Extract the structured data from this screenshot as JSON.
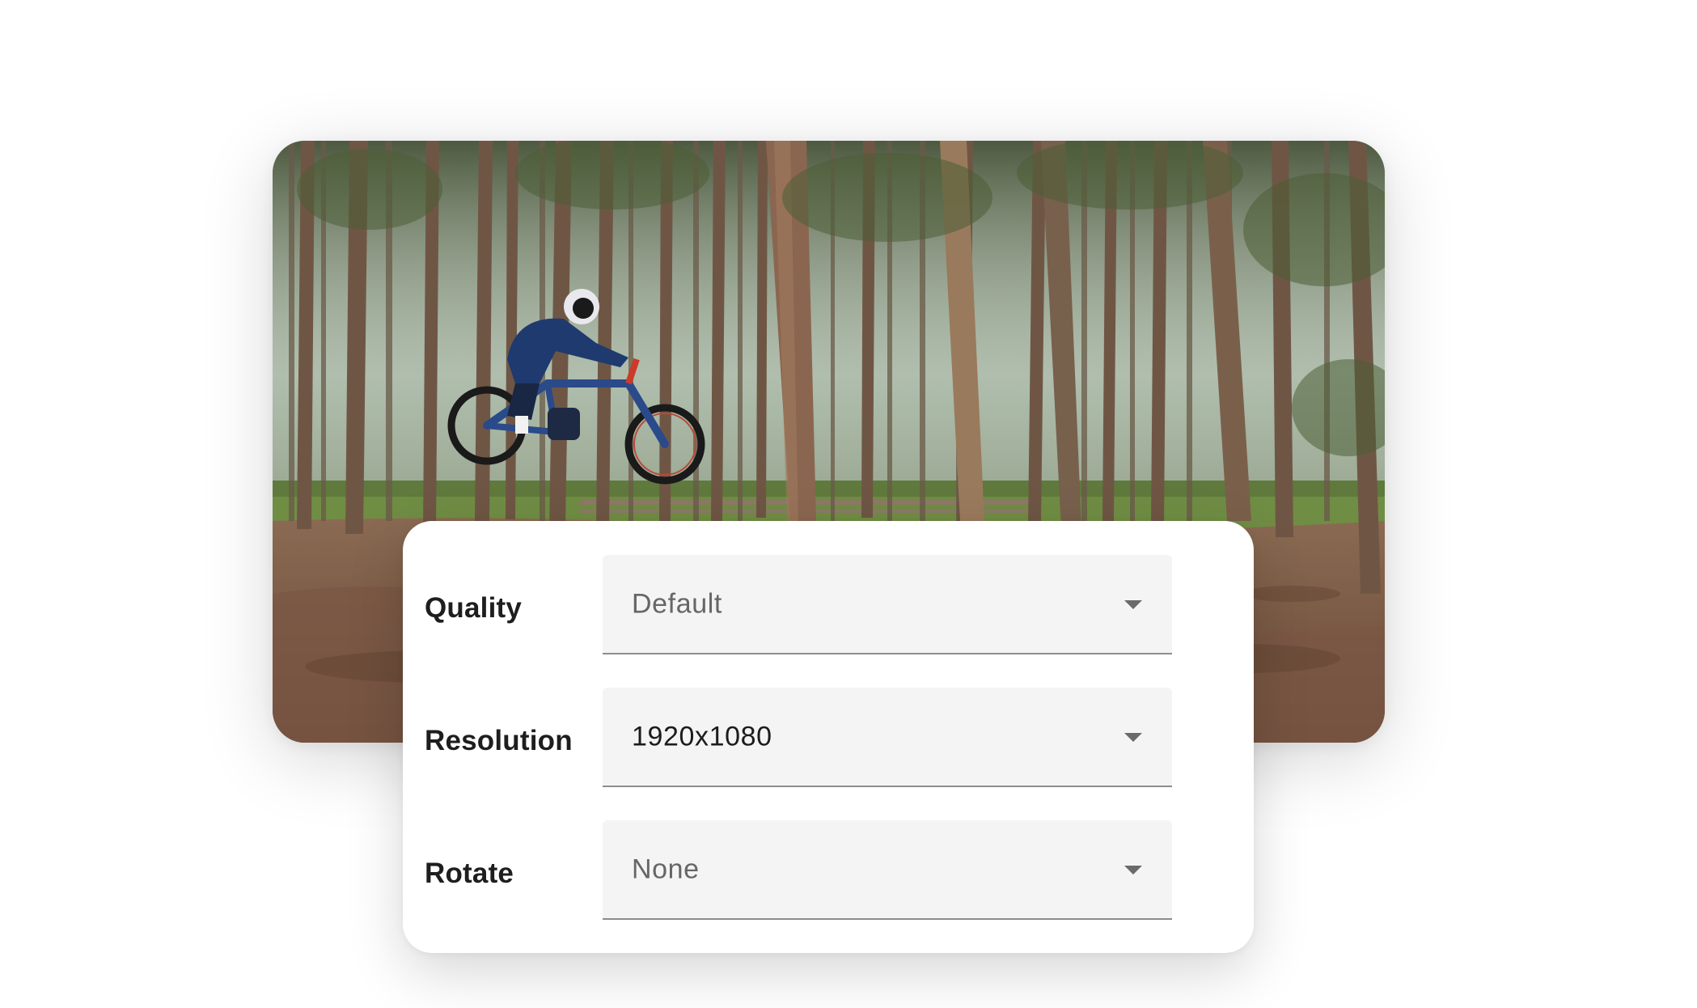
{
  "preview": {
    "image_description": "mountain-bike-rider-jumping-in-pine-forest"
  },
  "settings": [
    {
      "key": "quality",
      "label": "Quality",
      "value": "Default",
      "state": "placeholder",
      "icon": "dropdown-arrow-icon"
    },
    {
      "key": "resolution",
      "label": "Resolution",
      "value": "1920x1080",
      "state": "selected",
      "icon": "dropdown-arrow-icon"
    },
    {
      "key": "rotate",
      "label": "Rotate",
      "value": "None",
      "state": "placeholder",
      "icon": "dropdown-arrow-icon"
    }
  ],
  "colors": {
    "field_background": "#f4f4f4",
    "field_underline": "#8d8d8d",
    "label_text": "#1e1e1e",
    "placeholder_text": "#666666",
    "value_text": "#1c1c1c"
  }
}
